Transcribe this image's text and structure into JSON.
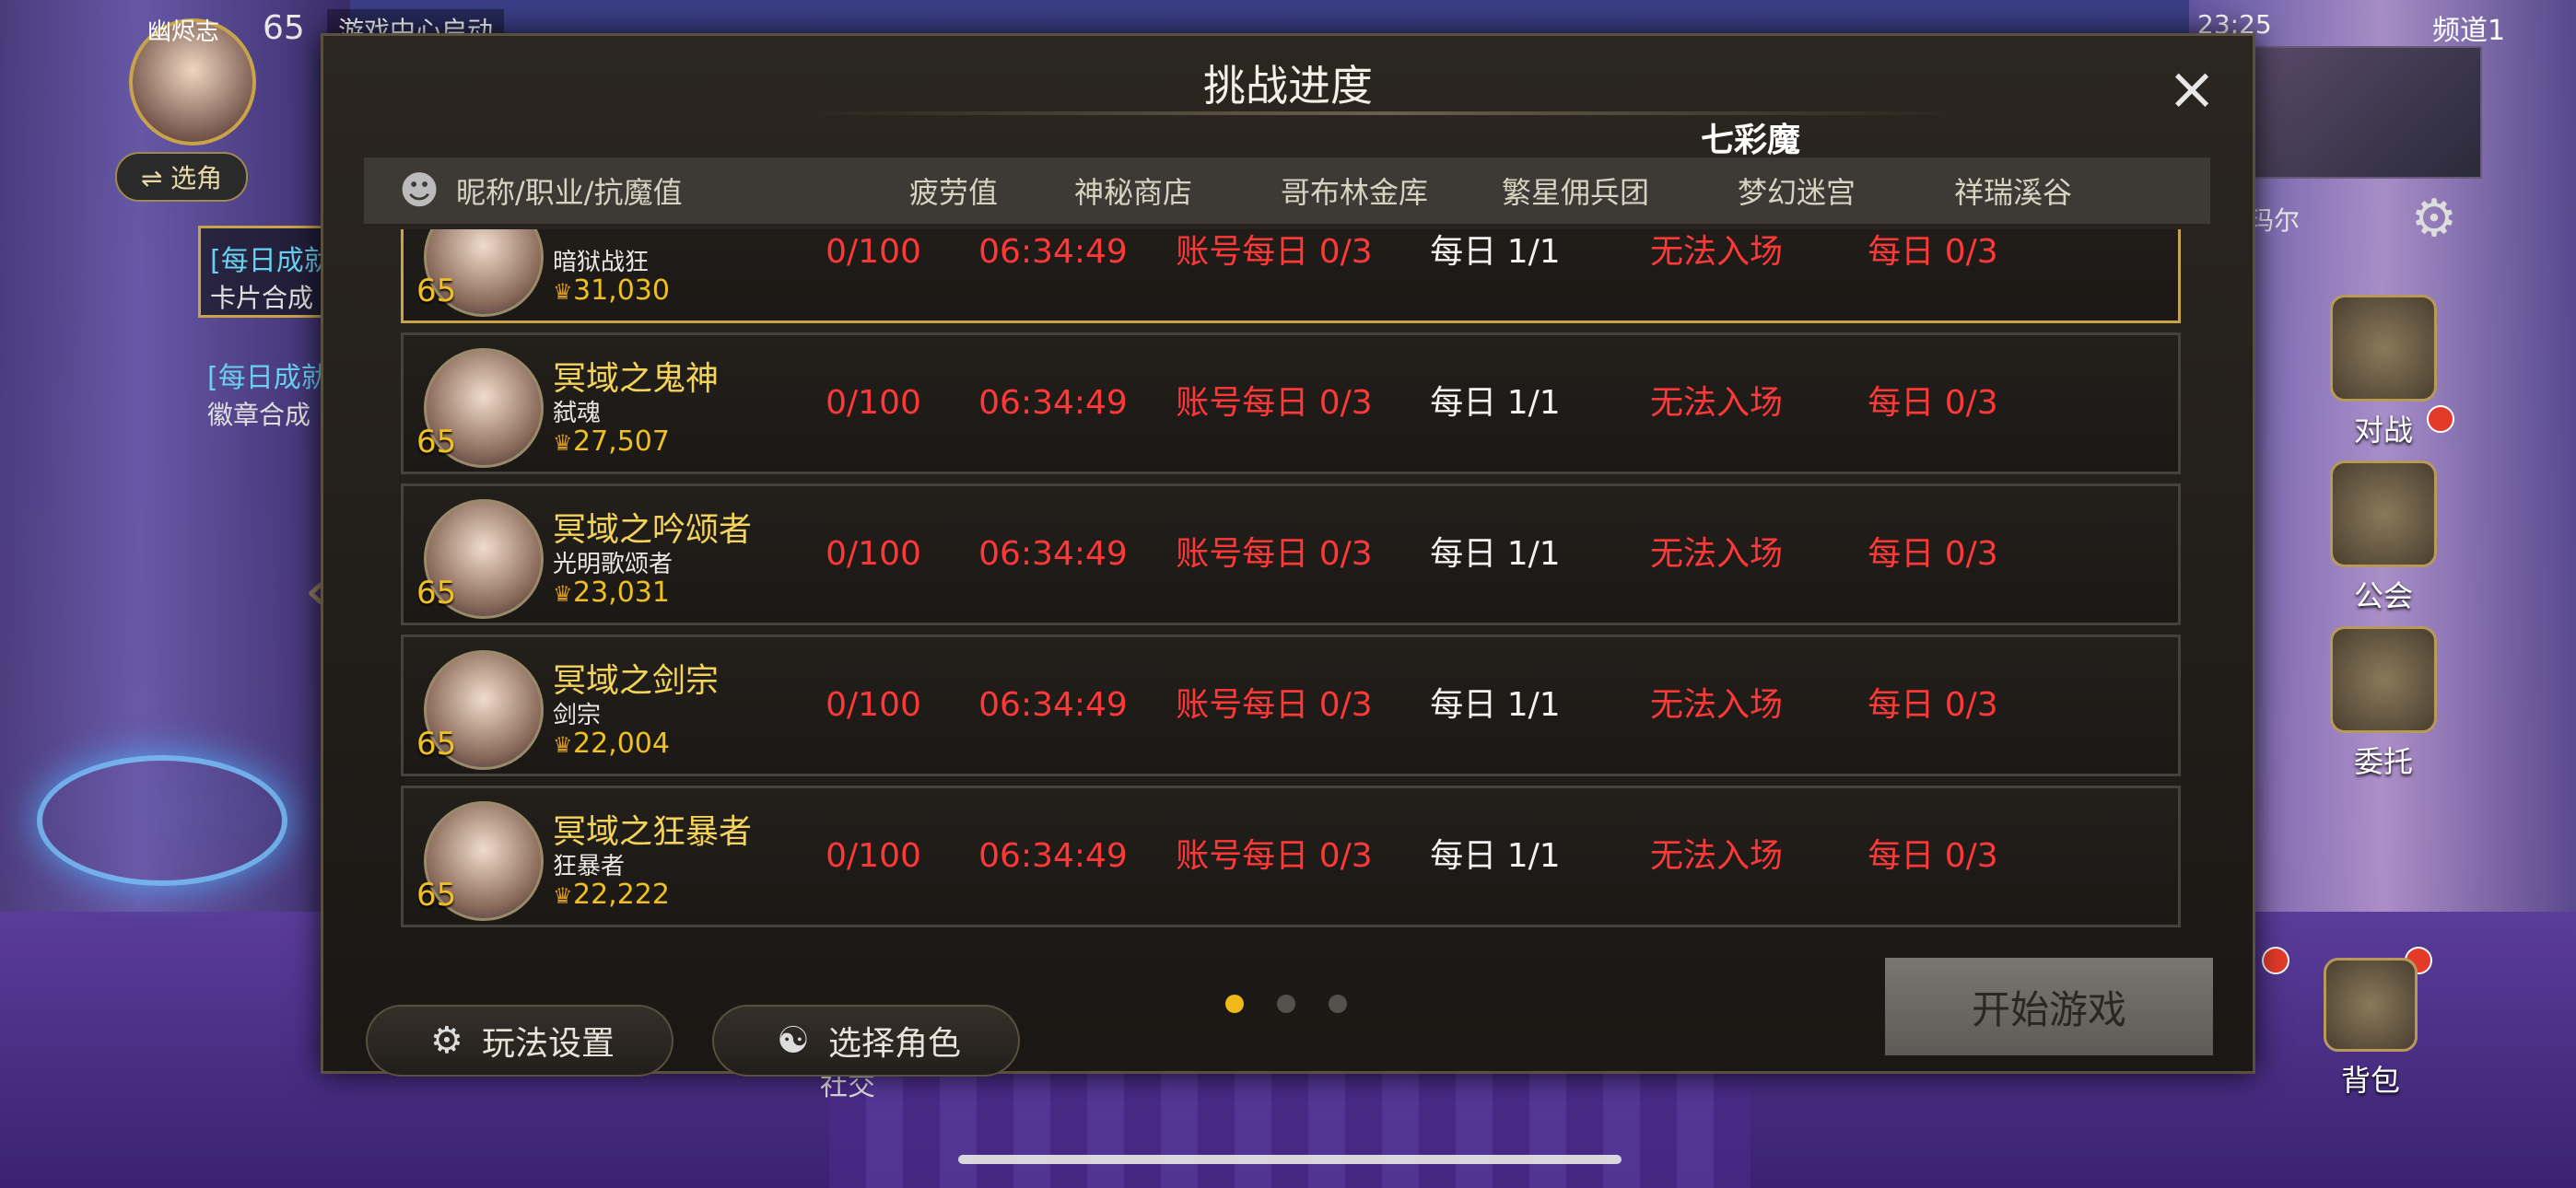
{
  "background": {
    "hud": {
      "player_name": "幽烬志",
      "level": "65",
      "notice": "游戏中心启动",
      "switch_label": "⇌ 选角",
      "quests": [
        {
          "title": "[每日成就",
          "subtitle": "卡片合成"
        },
        {
          "title": "[每日成就",
          "subtitle": "徽章合成"
        }
      ],
      "status_time": "23:25",
      "channel": "频道1",
      "map_label": "玛尔",
      "side_buttons": [
        "对战",
        "公会",
        "委托",
        "背包"
      ],
      "bottom_left_label": "社交"
    }
  },
  "panel": {
    "title": "挑战进度",
    "overflow_label": "七彩魔",
    "columns": [
      "昵称/职业/抗魔值",
      "疲劳值",
      "神秘商店",
      "哥布林金库",
      "繁星佣兵团",
      "梦幻迷宫",
      "祥瑞溪谷"
    ],
    "rows": [
      {
        "level": "65",
        "name": "",
        "job": "暗狱战狂",
        "power": "31,030",
        "fatigue": "0/100",
        "shop": "06:34:49",
        "goblin": "账号每日 0/3",
        "mercenary": "每日 1/1",
        "maze": "无法入场",
        "valley": "每日 0/3",
        "selected": true
      },
      {
        "level": "65",
        "name": "冥域之鬼神",
        "job": "弑魂",
        "power": "27,507",
        "fatigue": "0/100",
        "shop": "06:34:49",
        "goblin": "账号每日 0/3",
        "mercenary": "每日 1/1",
        "maze": "无法入场",
        "valley": "每日 0/3"
      },
      {
        "level": "65",
        "name": "冥域之吟颂者",
        "job": "光明歌颂者",
        "power": "23,031",
        "fatigue": "0/100",
        "shop": "06:34:49",
        "goblin": "账号每日 0/3",
        "mercenary": "每日 1/1",
        "maze": "无法入场",
        "valley": "每日 0/3"
      },
      {
        "level": "65",
        "name": "冥域之剑宗",
        "job": "剑宗",
        "power": "22,004",
        "fatigue": "0/100",
        "shop": "06:34:49",
        "goblin": "账号每日 0/3",
        "mercenary": "每日 1/1",
        "maze": "无法入场",
        "valley": "每日 0/3"
      },
      {
        "level": "65",
        "name": "冥域之狂暴者",
        "job": "狂暴者",
        "power": "22,222",
        "fatigue": "0/100",
        "shop": "06:34:49",
        "goblin": "账号每日 0/3",
        "mercenary": "每日 1/1",
        "maze": "无法入场",
        "valley": "每日 0/3"
      }
    ],
    "buttons": {
      "settings": "玩法设置",
      "select_character": "选择角色",
      "start": "开始游戏"
    },
    "pagination": {
      "total": 3,
      "current": 1
    }
  },
  "colors": {
    "accent_gold": "#c9a34a",
    "warning_red": "#ff3838",
    "name_yellow": "#f4d35a"
  }
}
